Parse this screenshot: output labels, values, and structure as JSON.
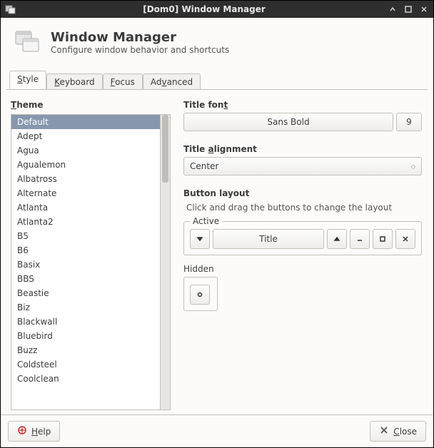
{
  "window": {
    "title": "[Dom0] Window Manager"
  },
  "header": {
    "title": "Window Manager",
    "subtitle": "Configure window behavior and shortcuts"
  },
  "tabs": [
    {
      "label_pre": "",
      "label_u": "S",
      "label_post": "tyle",
      "active": true
    },
    {
      "label_pre": "",
      "label_u": "K",
      "label_post": "eyboard",
      "active": false
    },
    {
      "label_pre": "",
      "label_u": "F",
      "label_post": "ocus",
      "active": false
    },
    {
      "label_pre": "Ad",
      "label_u": "v",
      "label_post": "anced",
      "active": false
    }
  ],
  "style_panel": {
    "theme_label_u": "T",
    "theme_label_post": "heme",
    "themes": [
      "Default",
      "Adept",
      "Agua",
      "Agualemon",
      "Albatross",
      "Alternate",
      "Atlanta",
      "Atlanta2",
      "B5",
      "B6",
      "Basix",
      "BBS",
      "Beastie",
      "Biz",
      "Blackwall",
      "Bluebird",
      "Buzz",
      "Coldsteel",
      "Coolclean"
    ],
    "selected_theme_index": 0,
    "font_label_pre": "Title fon",
    "font_label_u": "t",
    "font_name": "Sans Bold",
    "font_size": "9",
    "alignment_label_pre": "Title ",
    "alignment_label_u": "a",
    "alignment_label_post": "lignment",
    "alignment_value": "Center",
    "button_layout_label": "Button layout",
    "button_layout_hint": "Click and drag the buttons to change the layout",
    "active_legend": "Active",
    "hidden_legend": "Hidden",
    "title_button_label": "Title"
  },
  "footer": {
    "help_u": "H",
    "help_post": "elp",
    "close_u": "C",
    "close_post": "lose"
  }
}
